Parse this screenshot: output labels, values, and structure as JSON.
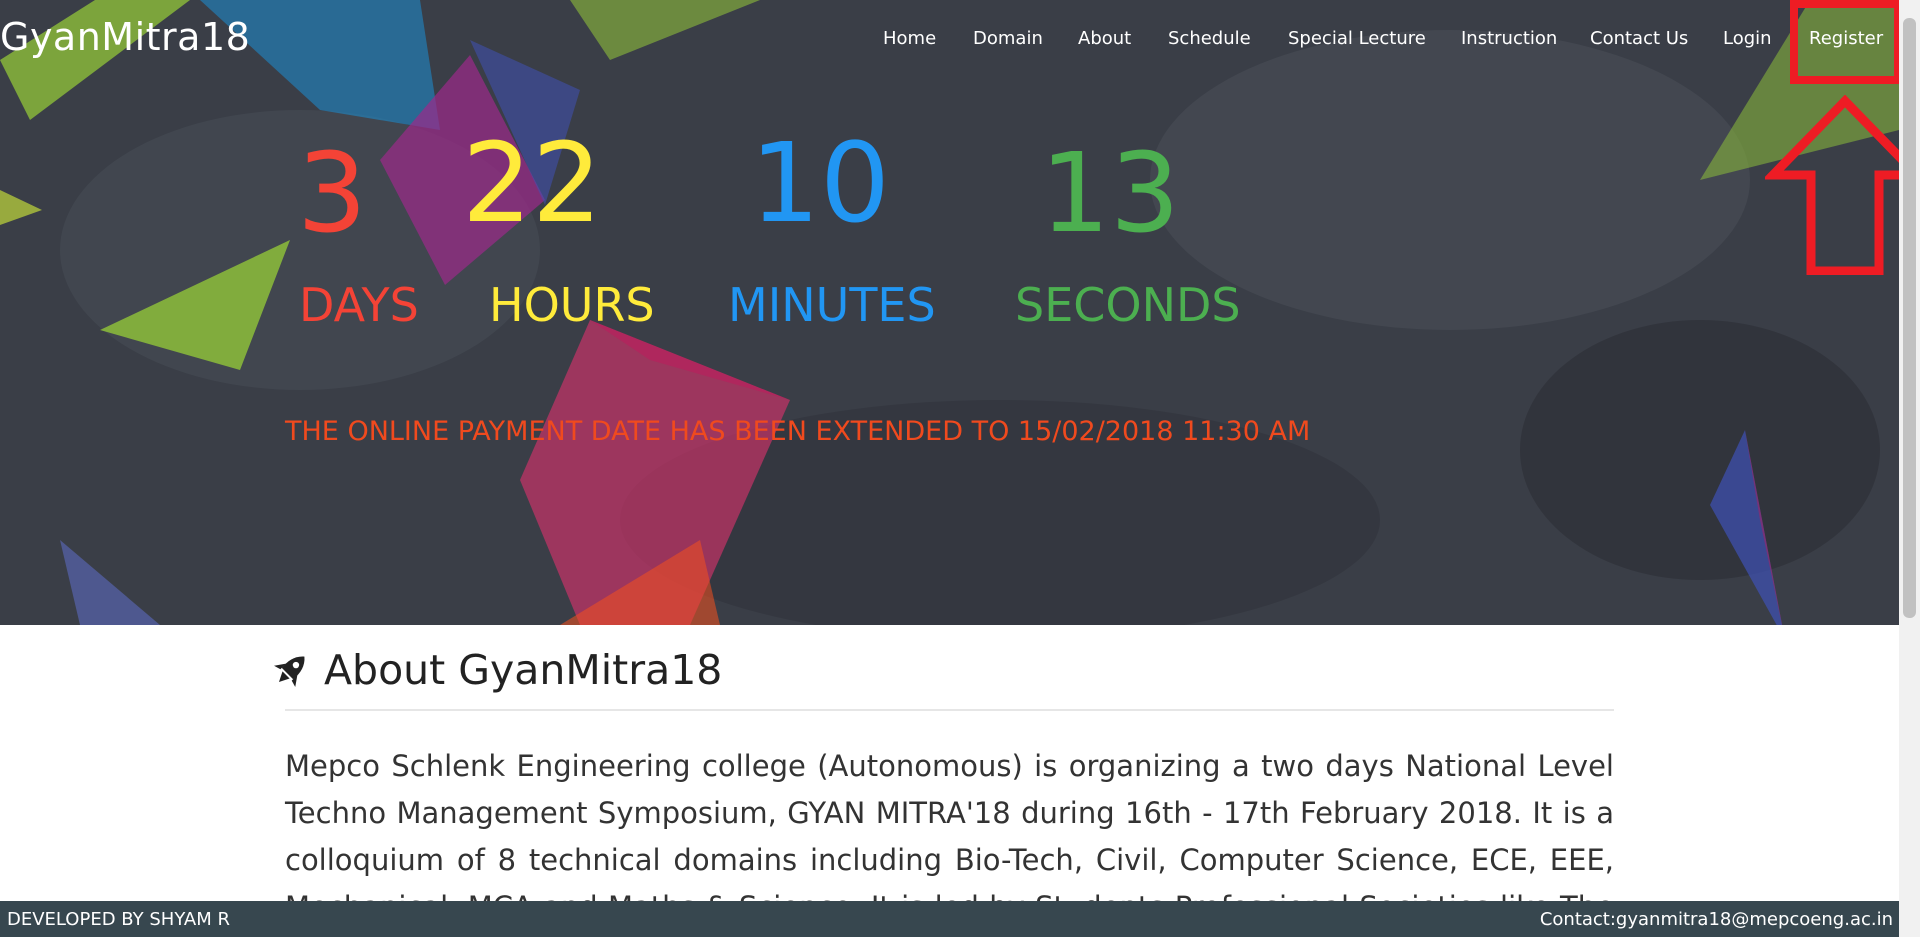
{
  "brand": "GyanMitra18",
  "nav": {
    "home": "Home",
    "domain": "Domain",
    "about": "About",
    "schedule": "Schedule",
    "special_lecture": "Special Lecture",
    "instruction": "Instruction",
    "contact_us": "Contact Us",
    "login": "Login",
    "register": "Register"
  },
  "countdown": {
    "days": {
      "value": "3",
      "label": "DAYS",
      "color": "#f44336"
    },
    "hours": {
      "value": "22",
      "label": "HOURS",
      "color": "#ffeb3b"
    },
    "minutes": {
      "value": "10",
      "label": "MINUTES",
      "color": "#2196f3"
    },
    "seconds": {
      "value": "13",
      "label": "SECONDS",
      "color": "#4caf50"
    }
  },
  "notice": "THE ONLINE PAYMENT DATE HAS BEEN EXTENDED TO 15/02/2018 11:30 AM",
  "about": {
    "icon": "rocket-icon",
    "title": "About GyanMitra18",
    "lines": [
      "Mepco Schlenk Engineering college (Autonomous) is organizing a two days National Level",
      "Techno Management Symposium, GYAN MITRA'18 during 16th - 17th February 2018. It is a",
      "colloquium of 8 technical domains including Bio-Tech, Civil, Computer Science, ECE, EEE,",
      "Mechanical, MCA and Maths & Science. It is led by Students Professional Societies like The"
    ]
  },
  "footer": {
    "left": "DEVELOPED BY SHYAM R",
    "right": "Contact:gyanmitra18@mepcoeng.ac.in"
  },
  "annotation_color": "#ee1c24"
}
